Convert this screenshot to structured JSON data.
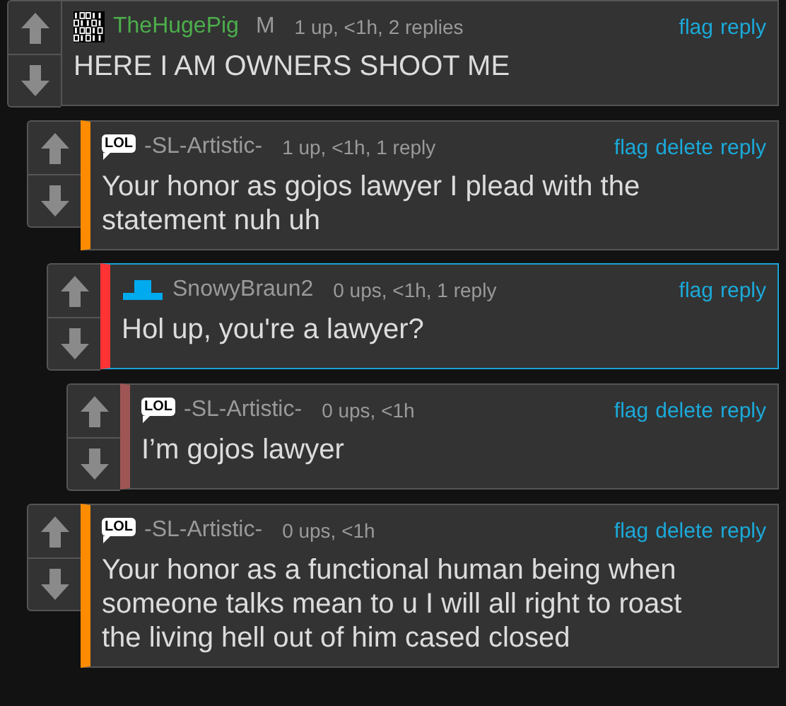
{
  "comments": [
    {
      "badge": {
        "kind": "binary"
      },
      "username": {
        "name": "TheHugePig",
        "color": "#4cae4c"
      },
      "mod_mark": "M",
      "meta": "1 up, <1h, 2 replies",
      "actions": [
        "flag",
        "reply"
      ],
      "text": "HERE I AM OWNERS SHOOT ME",
      "highlighted": false,
      "children": [
        {
          "badge": {
            "kind": "lol",
            "label": "LOL"
          },
          "username": {
            "name": "-SL-Artistic-",
            "color": "#9a9a9a"
          },
          "meta": "1 up, <1h, 1 reply",
          "actions": [
            "flag",
            "delete",
            "reply"
          ],
          "text": "Your honor as gojos lawyer I plead with the statement nuh uh",
          "color": "#ff8c00",
          "highlighted": false,
          "children": [
            {
              "badge": {
                "kind": "hat"
              },
              "username": {
                "name": "SnowyBraun2",
                "color": "#9a9a9a"
              },
              "meta": "0 ups, <1h, 1 reply",
              "actions": [
                "flag",
                "reply"
              ],
              "text": "Hol up, you're a lawyer?",
              "color": "#ff3333",
              "highlighted": true,
              "children": [
                {
                  "badge": {
                    "kind": "lol",
                    "label": "LOL"
                  },
                  "username": {
                    "name": "-SL-Artistic-",
                    "color": "#9a9a9a"
                  },
                  "meta": "0 ups, <1h",
                  "actions": [
                    "flag",
                    "delete",
                    "reply"
                  ],
                  "text": "I’m gojos lawyer",
                  "color": "#a05555",
                  "highlighted": false
                }
              ]
            }
          ]
        },
        {
          "badge": {
            "kind": "lol",
            "label": "LOL"
          },
          "username": {
            "name": "-SL-Artistic-",
            "color": "#9a9a9a"
          },
          "meta": "0 ups, <1h",
          "actions": [
            "flag",
            "delete",
            "reply"
          ],
          "text": "Your honor as a functional human being when someone talks mean to u I will all right to roast the living hell out of him cased closed",
          "color": "#ff8c00",
          "highlighted": false
        }
      ]
    }
  ]
}
